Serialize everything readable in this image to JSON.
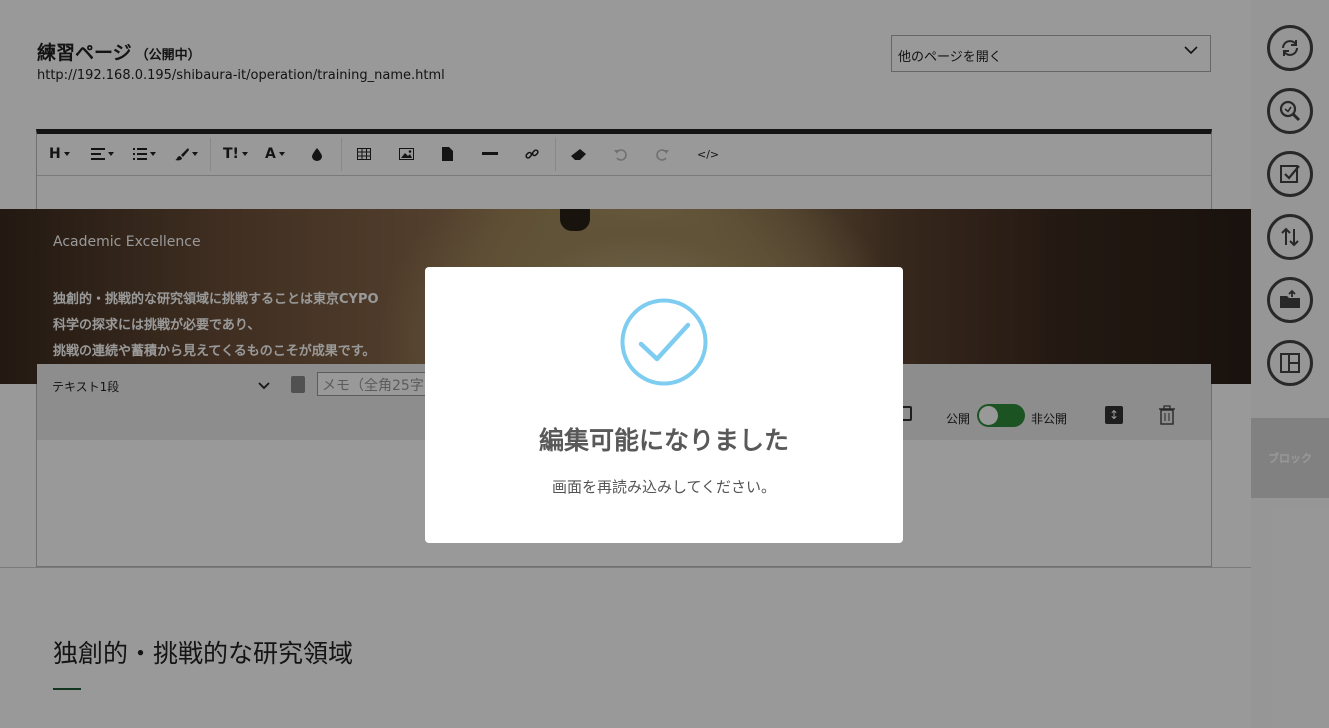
{
  "header": {
    "title": "練習ページ",
    "status": "（公開中）",
    "url": "http://192.168.0.195/shibaura-it/operation/training_name.html",
    "page_select": "他のページを開く"
  },
  "toolbar": {
    "heading": "H",
    "font_size": "T!",
    "font_color": "A",
    "code": "</>"
  },
  "hero": {
    "eyebrow": "Academic Excellence",
    "lines": [
      "独創的・挑戦的な研究領域に挑戦することは東京CYPO",
      "科学の探求には挑戦が必要であり、",
      "挑戦の連続や蓄積から見えてくるものこそが成果です。"
    ]
  },
  "block": {
    "type": "テキスト1段",
    "memo_placeholder": "メモ（全角25字",
    "public_label": "公開",
    "private_label": "非公開",
    "public": true
  },
  "section": {
    "title": "独創的・挑戦的な研究領域"
  },
  "rail": {
    "tab_label": "ブロック",
    "icons": [
      "refresh-icon",
      "search-icon",
      "checkbox-icon",
      "sort-icon",
      "folder-upload-icon",
      "layout-icon"
    ]
  },
  "modal": {
    "title": "編集可能になりました",
    "message": "画面を再読み込みしてください。",
    "accent_color": "#7ecdf0"
  }
}
